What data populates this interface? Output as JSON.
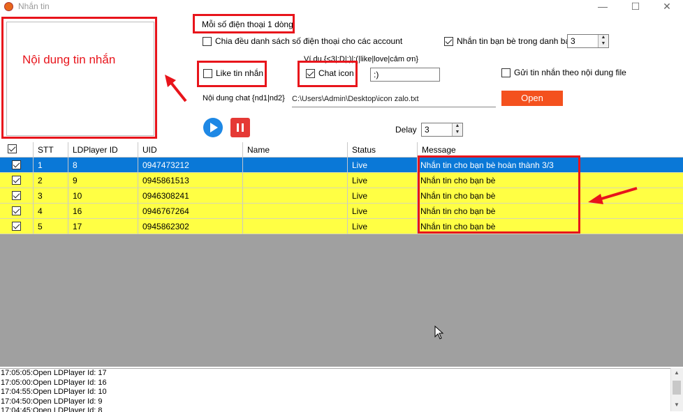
{
  "window": {
    "title": "Nhắn tin",
    "minimize": "—",
    "maximize": "☐",
    "close": "✕"
  },
  "message_box": {
    "label": "Nội dung tin nhắn"
  },
  "phone_hint": "Mỗi số điện thoại 1 dòng",
  "options": {
    "split_phones_label": "Chia đều danh sách số điện thoại cho các account",
    "split_phones_checked": false,
    "message_friends_label": "Nhắn tin bạn bè trong danh bạ",
    "message_friends_checked": true,
    "friends_count": "3",
    "like_message_label": "Like tin nhắn",
    "like_message_checked": false,
    "chat_icon_label": "Chat icon",
    "chat_icon_checked": true,
    "icon_example": "Ví du {<3|:D|:)|:(|like|love|cảm ơn}",
    "icon_value": ":)",
    "send_by_file_label": "Gửi tin nhắn theo nội dung file",
    "send_by_file_checked": false,
    "chat_content_label": "Nội dung chat {nd1|nd2}",
    "chat_file_path": "C:\\Users\\Admin\\Desktop\\icon zalo.txt",
    "open_button": "Open",
    "delay_label": "Delay",
    "delay_value": "3"
  },
  "colors": {
    "accent_red": "#e8141b",
    "open_button": "#f4511e",
    "play_button": "#1e88e5",
    "stop_button": "#e53935",
    "row_yellow": "#ffff44",
    "row_selected": "#0a78d7"
  },
  "table": {
    "columns": [
      "STT",
      "LDPlayer ID",
      "UID",
      "Name",
      "Status",
      "Message"
    ],
    "rows": [
      {
        "checked": true,
        "stt": "1",
        "ldplayer_id": "8",
        "uid": "0947473212",
        "name": "",
        "status": "Live",
        "message": "Nhắn tin cho bạn bè hoàn thành 3/3",
        "selected": true
      },
      {
        "checked": true,
        "stt": "2",
        "ldplayer_id": "9",
        "uid": "0945861513",
        "name": "",
        "status": "Live",
        "message": "Nhắn tin cho bạn bè",
        "selected": false
      },
      {
        "checked": true,
        "stt": "3",
        "ldplayer_id": "10",
        "uid": "0946308241",
        "name": "",
        "status": "Live",
        "message": "Nhắn tin cho bạn bè",
        "selected": false
      },
      {
        "checked": true,
        "stt": "4",
        "ldplayer_id": "16",
        "uid": "0946767264",
        "name": "",
        "status": "Live",
        "message": "Nhắn tin cho bạn bè",
        "selected": false
      },
      {
        "checked": true,
        "stt": "5",
        "ldplayer_id": "17",
        "uid": "0945862302",
        "name": "",
        "status": "Live",
        "message": "Nhắn tin cho bạn bè",
        "selected": false
      }
    ]
  },
  "log": [
    "17:05:05:Open LDPlayer Id: 17",
    "17:05:00:Open LDPlayer Id: 16",
    "17:04:55:Open LDPlayer Id: 10",
    "17:04:50:Open LDPlayer Id: 9",
    "17:04:45:Open LDPlayer Id: 8"
  ]
}
